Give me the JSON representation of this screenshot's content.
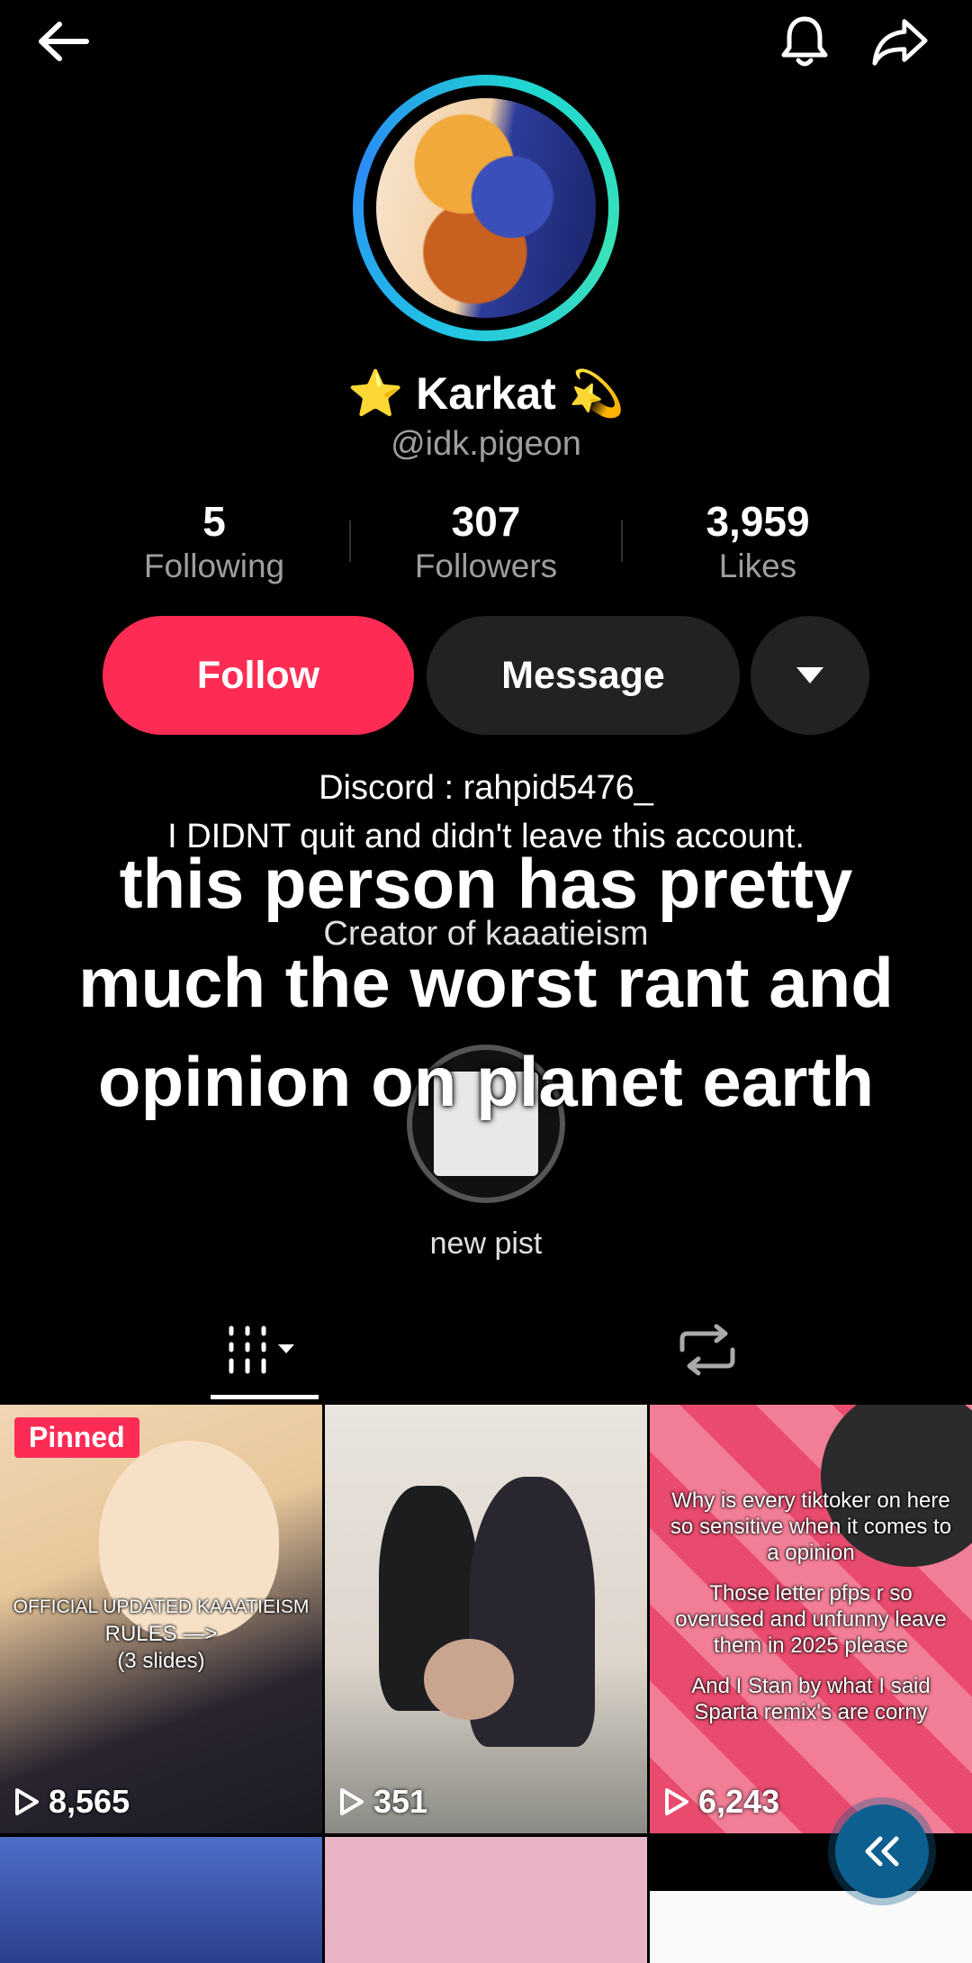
{
  "header": {
    "back_icon": "arrow-left-icon",
    "bell_icon": "bell-icon",
    "share_icon": "share-arrow-icon"
  },
  "profile": {
    "display_name": "⭐ Karkat 💫",
    "username": "@idk.pigeon"
  },
  "stats": [
    {
      "value": "5",
      "label": "Following"
    },
    {
      "value": "307",
      "label": "Followers"
    },
    {
      "value": "3,959",
      "label": "Likes"
    }
  ],
  "actions": {
    "follow_label": "Follow",
    "message_label": "Message",
    "more_icon": "caret-down-icon"
  },
  "bio": {
    "line1": "Discord : rahpid5476_",
    "line2": "I DIDNT quit and didn't leave this account.",
    "line3": "Creator of kaaatieism"
  },
  "overlay_caption": {
    "line1": "this person has pretty",
    "line2": "much the worst rant and",
    "line3": "opinion on planet earth"
  },
  "highlight": {
    "label": "new pist"
  },
  "tabs": {
    "videos_icon": "grid-icon",
    "reposts_icon": "repost-icon"
  },
  "videos": [
    {
      "views": "8,565",
      "pinned_label": "Pinned",
      "caption": [
        "OFFICIAL UPDATED KAAATIEISM",
        "RULES —>",
        "(3 slides)"
      ]
    },
    {
      "views": "351"
    },
    {
      "views": "6,243",
      "caption": [
        "Why is every tiktoker on here",
        "so sensitive when it comes to",
        "a opinion",
        "",
        "Those letter pfps r so",
        "overused and unfunny leave",
        "them in 2025 please",
        "",
        "And I Stan by what I said",
        "Sparta remix's are corny"
      ]
    }
  ],
  "colors": {
    "accent": "#fe2c55",
    "button_dark": "#222222",
    "fab": "#0d5f8f"
  }
}
